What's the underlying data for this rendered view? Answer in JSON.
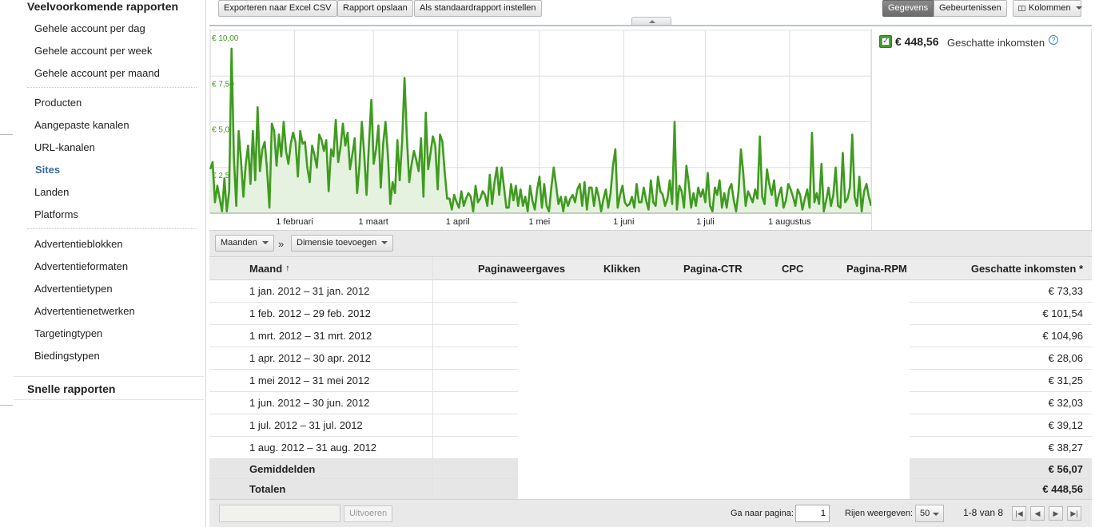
{
  "sidebar": {
    "section_title": "Veelvoorkomende rapporten",
    "group1": [
      "Gehele account per dag",
      "Gehele account per week",
      "Gehele account per maand"
    ],
    "group2": [
      "Producten",
      "Aangepaste kanalen",
      "URL-kanalen",
      "Sites",
      "Landen",
      "Platforms"
    ],
    "active_item": "Sites",
    "group3": [
      "Advertentieblokken",
      "Advertentieformaten",
      "Advertentietypen",
      "Advertentienetwerken",
      "Targetingtypen",
      "Biedingstypen"
    ],
    "quick_reports": "Snelle rapporten"
  },
  "toolbar": {
    "export_label": "Exporteren naar Excel CSV",
    "save_label": "Rapport opslaan",
    "default_label": "Als standaardrapport instellen",
    "toggle_data": "Gegevens",
    "toggle_events": "Gebeurtenissen",
    "columns_label": "Kolommen",
    "columns_icon": "table-icon"
  },
  "legend": {
    "value": "€ 448,56",
    "label": "Geschatte inkomsten",
    "checked": true,
    "help_icon": "help-icon"
  },
  "chart_data": {
    "type": "area",
    "series": [
      {
        "name": "Geschatte inkomsten",
        "color": "#3f9b1f"
      }
    ],
    "y_ticks": [
      "€ 2,50",
      "€ 5,00",
      "€ 7,50",
      "€ 10,00"
    ],
    "ylim": [
      0,
      10
    ],
    "x_ticks": [
      "1 februari",
      "1 maart",
      "1 april",
      "1 mei",
      "1 juni",
      "1 juli",
      "1 augustus"
    ],
    "x_range": [
      "2012-01-01",
      "2012-08-31"
    ],
    "grid": true,
    "line_color": "#3f9b1f",
    "fill_color": "#e6f2e0",
    "values": [
      2.4,
      2.8,
      0.6,
      1.5,
      0.8,
      0.1,
      1.9,
      0.1,
      1.2,
      9.0,
      3.1,
      0.4,
      4.5,
      2.9,
      0.9,
      2.7,
      3.7,
      1.6,
      4.5,
      1.8,
      5.8,
      2.3,
      3.5,
      3.9,
      2.4,
      0.3,
      4.9,
      4.5,
      2.6,
      4.3,
      3.1,
      5.0,
      3.4,
      2.7,
      3.8,
      4.4,
      3.9,
      2.0,
      4.5,
      3.8,
      3.9,
      2.5,
      1.7,
      3.7,
      3.2,
      2.5,
      4.3,
      4.0,
      3.4,
      4.0,
      1.2,
      3.5,
      3.1,
      5.1,
      2.8,
      3.6,
      4.9,
      3.7,
      4.4,
      2.4,
      3.2,
      4.1,
      1.1,
      2.6,
      5.0,
      3.2,
      1.0,
      3.8,
      6.2,
      2.7,
      3.5,
      4.8,
      1.4,
      3.8,
      5.0,
      3.2,
      0.5,
      1.7,
      1.1,
      4.0,
      1.8,
      3.9,
      7.4,
      4.2,
      1.7,
      2.7,
      3.4,
      2.9,
      2.3,
      4.1,
      0.9,
      5.5,
      2.4,
      3.3,
      4.2,
      3.7,
      1.3,
      4.3,
      3.9,
      2.2,
      0.8,
      0.8,
      0.2,
      1.0,
      0.6,
      0.3,
      1.2,
      0.4,
      0.8,
      1.1,
      0.9,
      0.1,
      1.5,
      0.6,
      0.8,
      1.2,
      1.0,
      0.4,
      2.1,
      0.5,
      1.7,
      2.5,
      1.0,
      2.5,
      1.4,
      0.3,
      0.3,
      1.6,
      0.7,
      1.5,
      0.4,
      1.3,
      0.4,
      0.9,
      0.1,
      1.5,
      0.7,
      0.2,
      1.3,
      2.0,
      0.3,
      1.6,
      0.4,
      0.1,
      1.4,
      2.5,
      1.5,
      0.5,
      0.9,
      0.1,
      0.9,
      0.4,
      0.8,
      1.0,
      0.6,
      1.3,
      1.6,
      0.4,
      1.7,
      0.2,
      1.4,
      1.4,
      0.4,
      1.4,
      0.9,
      0.1,
      0.8,
      1.3,
      0.3,
      1.1,
      2.6,
      3.5,
      0.3,
      1.0,
      1.5,
      0.6,
      0.4,
      0.5,
      0.9,
      0.3,
      1.6,
      0.6,
      0.6,
      1.4,
      0.7,
      0.2,
      1.8,
      0.6,
      0.4,
      2.0,
      1.2,
      1.0,
      0.4,
      0.8,
      1.8,
      0.5,
      5.0,
      0.2,
      1.5,
      1.2,
      0.3,
      2.6,
      1.6,
      0.3,
      1.1,
      0.4,
      1.4,
      0.9,
      1.3,
      0.6,
      2.2,
      0.4,
      0.1,
      1.4,
      1.0,
      1.8,
      0.3,
      1.1,
      0.3,
      1.3,
      1.6,
      0.7,
      0.1,
      1.2,
      3.5,
      2.2,
      0.4,
      1.2,
      0.9,
      0.6,
      1.3,
      0.8,
      4.2,
      0.9,
      0.5,
      2.4,
      1.6,
      1.0,
      1.8,
      0.4,
      1.0,
      1.4,
      0.3,
      0.7,
      1.6,
      1.3,
      0.9,
      0.4,
      1.3,
      1.0,
      0.2,
      0.8,
      1.3,
      0.3,
      4.4,
      0.6,
      1.1,
      0.5,
      2.7,
      0.1,
      0.7,
      1.4,
      0.4,
      1.0,
      2.5,
      0.4,
      0.3,
      3.3,
      0.6,
      0.8,
      1.4,
      4.3,
      0.9,
      0.4,
      2.0,
      0.1,
      1.2,
      1.6,
      0.9,
      0.4
    ]
  },
  "table_toolbar": {
    "period_label": "Maanden",
    "arrow": "»",
    "dimension_label": "Dimensie toevoegen"
  },
  "table": {
    "columns": [
      "Maand",
      "Paginaweergaves",
      "Klikken",
      "Pagina-CTR",
      "CPC",
      "Pagina-RPM",
      "Geschatte inkomsten *"
    ],
    "sort_indicator": "↑",
    "rows": [
      {
        "month": "1 jan. 2012 – 31 jan. 2012",
        "revenue": "€ 73,33"
      },
      {
        "month": "1 feb. 2012 – 29 feb. 2012",
        "revenue": "€ 101,54"
      },
      {
        "month": "1 mrt. 2012 – 31 mrt. 2012",
        "revenue": "€ 104,96"
      },
      {
        "month": "1 apr. 2012 – 30 apr. 2012",
        "revenue": "€ 28,06"
      },
      {
        "month": "1 mei 2012 – 31 mei 2012",
        "revenue": "€ 31,25"
      },
      {
        "month": "1 jun. 2012 – 30 jun. 2012",
        "revenue": "€ 32,03"
      },
      {
        "month": "1 jul. 2012 – 31 jul. 2012",
        "revenue": "€ 39,12"
      },
      {
        "month": "1 aug. 2012 – 31 aug. 2012",
        "revenue": "€ 38,27"
      }
    ],
    "averages": {
      "label": "Gemiddelden",
      "revenue": "€ 56,07"
    },
    "totals": {
      "label": "Totalen",
      "revenue": "€ 448,56"
    }
  },
  "footer": {
    "filter_value": "",
    "run_label": "Uitvoeren",
    "goto_label": "Ga naar pagina:",
    "goto_value": "1",
    "rows_label": "Rijen weergeven:",
    "rows_value": "50",
    "range_label": "1-8 van 8",
    "pager_icons": [
      "first-page-icon",
      "prev-page-icon",
      "next-page-icon",
      "last-page-icon"
    ]
  }
}
